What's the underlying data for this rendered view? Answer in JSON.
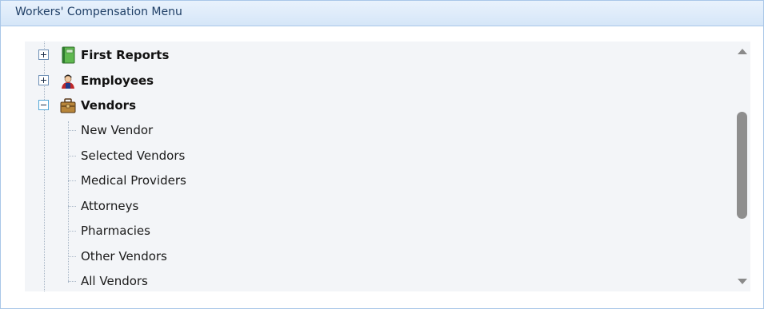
{
  "panel": {
    "title": "Workers' Compensation Menu"
  },
  "tree": {
    "nodes": [
      {
        "label": "First Reports",
        "expanded": false,
        "icon": "green-book-icon"
      },
      {
        "label": "Employees",
        "expanded": false,
        "icon": "worker-person-icon"
      },
      {
        "label": "Vendors",
        "expanded": true,
        "icon": "briefcase-icon"
      }
    ],
    "vendor_children": [
      "New Vendor",
      "Selected Vendors",
      "Medical Providers",
      "Attorneys",
      "Pharmacies",
      "Other Vendors",
      "All Vendors"
    ]
  },
  "scrollbar": {
    "up_icon": "scroll-up-arrow-icon",
    "down_icon": "scroll-down-arrow-icon"
  }
}
